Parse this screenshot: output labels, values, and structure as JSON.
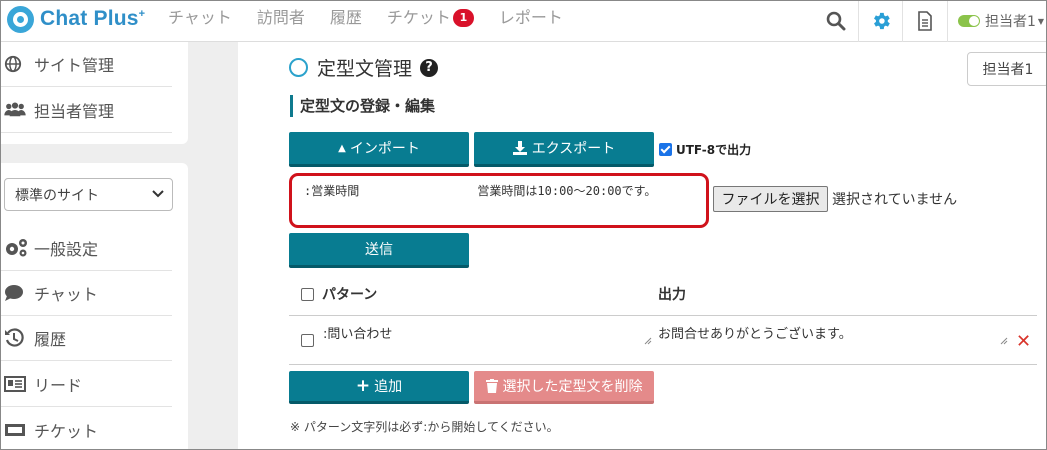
{
  "header": {
    "logo_text": "Chat Plus",
    "logo_sup": "+",
    "nav": [
      "チャット",
      "訪問者",
      "履歴",
      "チケット",
      "レポート"
    ],
    "ticket_badge": "1",
    "user_name": "担当者1",
    "toggle_color": "#8bc34a"
  },
  "sidebar": {
    "top_items": [
      {
        "label": "サイト管理",
        "icon": "globe-icon"
      },
      {
        "label": "担当者管理",
        "icon": "users-icon"
      }
    ],
    "site_select": "標準のサイト",
    "items": [
      {
        "label": "一般設定",
        "icon": "gears-icon"
      },
      {
        "label": "チャット",
        "icon": "speech-bubble-icon"
      },
      {
        "label": "履歴",
        "icon": "history-icon"
      },
      {
        "label": "リード",
        "icon": "id-card-icon"
      },
      {
        "label": "チケット",
        "icon": "ticket-icon"
      }
    ]
  },
  "main": {
    "title": "定型文管理",
    "agent_button": "担当者1",
    "section_title": "定型文の登録・編集",
    "import_label": "インポート",
    "export_label": "エクスポート",
    "utf8_label": "UTF-8で出力",
    "utf8_checked": true,
    "textarea_value": ":営業時間\t\t営業時間は10:00～20:00です。",
    "file_button": "ファイルを選択",
    "file_status": "選択されていません",
    "send_label": "送信",
    "table": {
      "col_pattern": "パターン",
      "col_output": "出力",
      "rows": [
        {
          "pattern": ":問い合わせ",
          "output": "お問合せありがとうございます。"
        }
      ]
    },
    "add_label": "追加",
    "delete_selected_label": "選択した定型文を削除",
    "note": "※ パターン文字列は必ず:から開始してください。"
  },
  "colors": {
    "teal": "#087c91",
    "highlight_red": "#d0121b",
    "brand_blue": "#2f8fc8"
  }
}
